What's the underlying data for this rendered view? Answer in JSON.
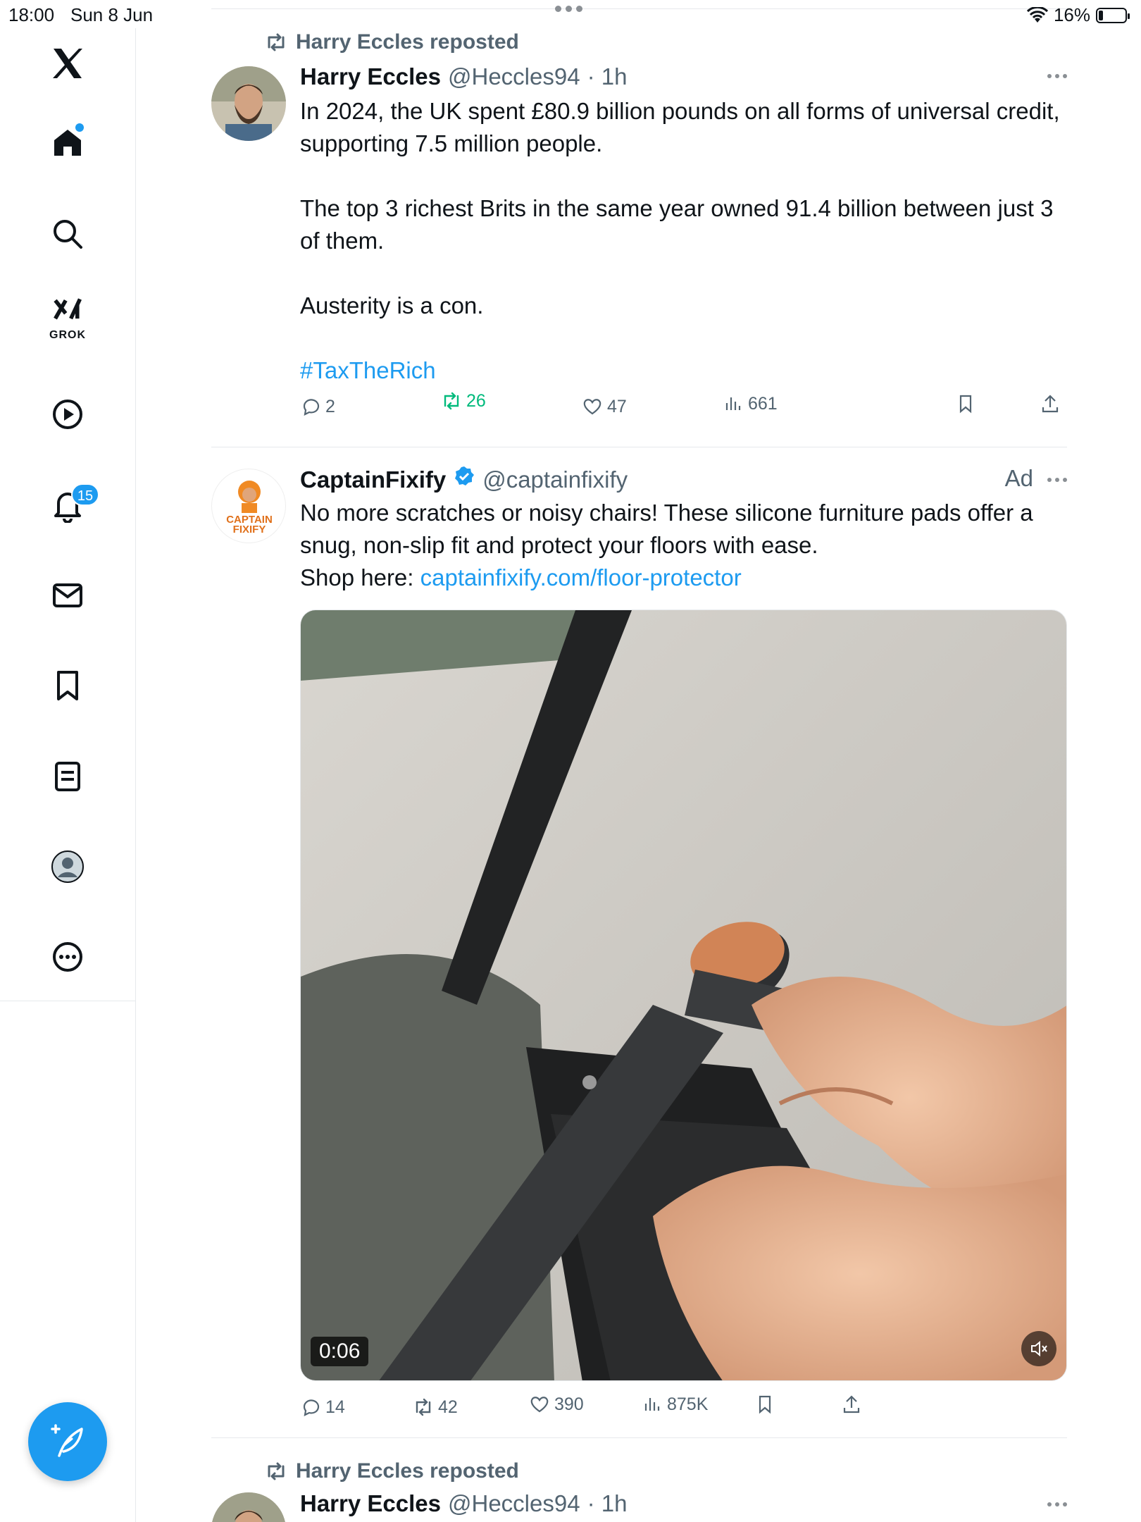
{
  "status_bar": {
    "time": "18:00",
    "date": "Sun 8 Jun",
    "battery_text": "16%",
    "battery_level": 0.16
  },
  "sidebar": {
    "grok_label": "GROK",
    "notifications_count": "15",
    "items": [
      "x-logo",
      "home",
      "explore",
      "grok",
      "video",
      "notifications",
      "messages",
      "bookmarks",
      "lists",
      "profile",
      "more"
    ]
  },
  "colors": {
    "accent": "#1d9bf0",
    "repost_green": "#00ba7c",
    "muted": "#536471"
  },
  "tweets": [
    {
      "repost_text": "Harry Eccles reposted",
      "name": "Harry Eccles",
      "handle": "@Heccles94",
      "time": "· 1h",
      "body": [
        "In 2024, the UK spent £80.9 billion pounds on all forms of universal credit, supporting 7.5 million people.",
        "",
        "The top 3 richest Brits in the same year owned 91.4 billion between just 3 of them.",
        "",
        "Austerity is a con.",
        ""
      ],
      "hashtag": "#TaxTheRich",
      "stats": {
        "replies": "2",
        "reposts": "26",
        "likes": "47",
        "views": "661"
      }
    },
    {
      "name": "CaptainFixify",
      "handle": "@captainfixify",
      "ad_label": "Ad",
      "avatar_text_line1": "CAPTAIN",
      "avatar_text_line2": "FIXIFY",
      "body": [
        "No more scratches or noisy chairs! These silicone furniture pads offer a snug, non-slip fit and protect your floors with ease."
      ],
      "shop_prefix": "Shop here: ",
      "shop_link": "captainfixify.com/floor-protector",
      "video_time": "0:06",
      "stats": {
        "replies": "14",
        "reposts": "42",
        "likes": "390",
        "views": "875K"
      }
    },
    {
      "repost_text": "Harry Eccles reposted",
      "name": "Harry Eccles",
      "handle": "@Heccles94",
      "time": "· 1h"
    }
  ]
}
